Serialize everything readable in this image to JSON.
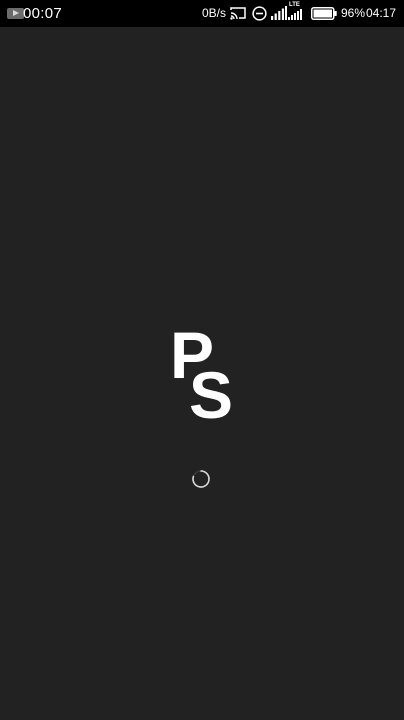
{
  "status_bar": {
    "recording_time": "00:07",
    "network_speed": "0B/s",
    "network_type": "LTE",
    "battery_percent": "96%",
    "time": "04:17",
    "icons": [
      "screen-record-icon",
      "cast-icon",
      "do-not-disturb-icon",
      "signal-icon",
      "signal-lte-icon",
      "battery-icon"
    ]
  },
  "splash": {
    "logo_letter_1": "P",
    "logo_letter_2": "S",
    "loading": true
  },
  "colors": {
    "background": "#222222",
    "status_bar": "#000000",
    "foreground": "#ffffff"
  }
}
